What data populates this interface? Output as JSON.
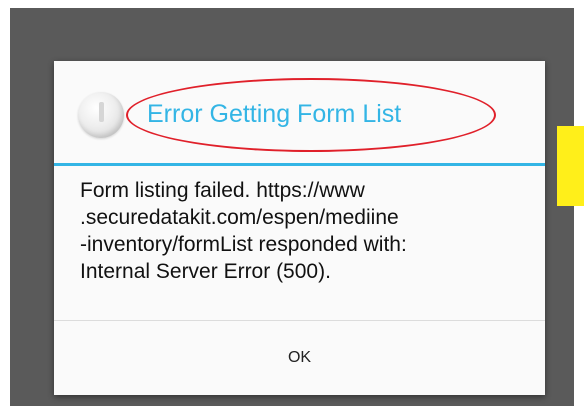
{
  "dialog": {
    "icon": "info-icon",
    "title": "Error Getting Form List",
    "message_lines": [
      "Form listing failed. https://www",
      ".securedatakit.com/espen/mediine",
      "-inventory/formList responded with:",
      "Internal Server Error (500)."
    ],
    "ok_label": "OK"
  },
  "colors": {
    "title": "#33b5e5",
    "header_divider": "#33b5e5",
    "annotation_circle": "#e0202a",
    "highlight_box": "#ffef1a",
    "backdrop": "#5a5a5a"
  }
}
